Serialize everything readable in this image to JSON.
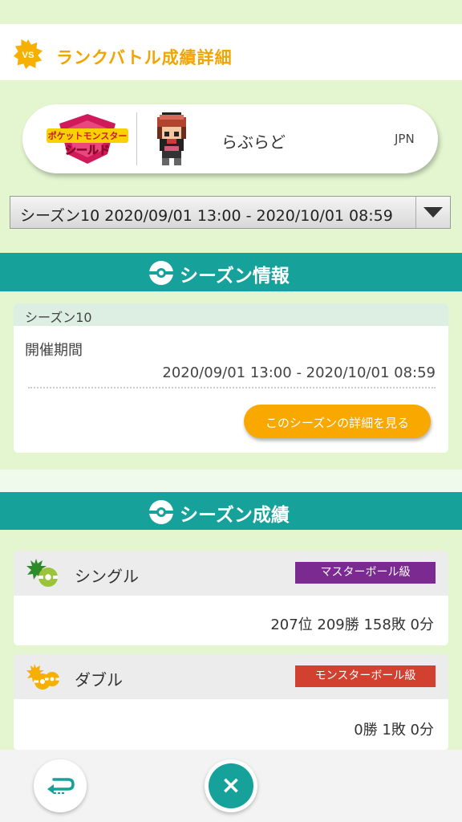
{
  "header": {
    "title": "ランクバトル成績詳細",
    "badge_text": "VS"
  },
  "profile": {
    "game_logo_line1": "ポケットモンスター",
    "game_logo_line2": "シールド",
    "player_name": "らぶらど",
    "region": "JPN"
  },
  "season_select": {
    "value": "シーズン10 2020/09/01 13:00 - 2020/10/01 08:59"
  },
  "season_info": {
    "section_title": "シーズン情報",
    "season_name": "シーズン10",
    "period_label": "開催期間",
    "period_value": "2020/09/01 13:00 - 2020/10/01 08:59",
    "detail_button": "このシーズンの詳細を見る"
  },
  "season_results": {
    "section_title": "シーズン成績",
    "single": {
      "name": "シングル",
      "rank_class": "マスターボール級",
      "result": "207位 209勝 158敗 0分"
    },
    "double": {
      "name": "ダブル",
      "rank_class": "モンスターボール級",
      "result": "0勝 1敗 0分"
    }
  },
  "colors": {
    "accent_teal": "#16a29a",
    "title_orange": "#f2a400",
    "button_orange": "#f9a800",
    "master_ball_purple": "#7b2a91",
    "monster_ball_red": "#d2402f",
    "background_green": "#e3f6d0"
  },
  "icons": {
    "header": "vs-badge-icon",
    "section": "pokeball-icon",
    "single": "single-battle-icon",
    "double": "double-battle-icon",
    "back": "back-arrow-icon",
    "close": "close-icon",
    "dropdown": "dropdown-arrow-icon"
  }
}
